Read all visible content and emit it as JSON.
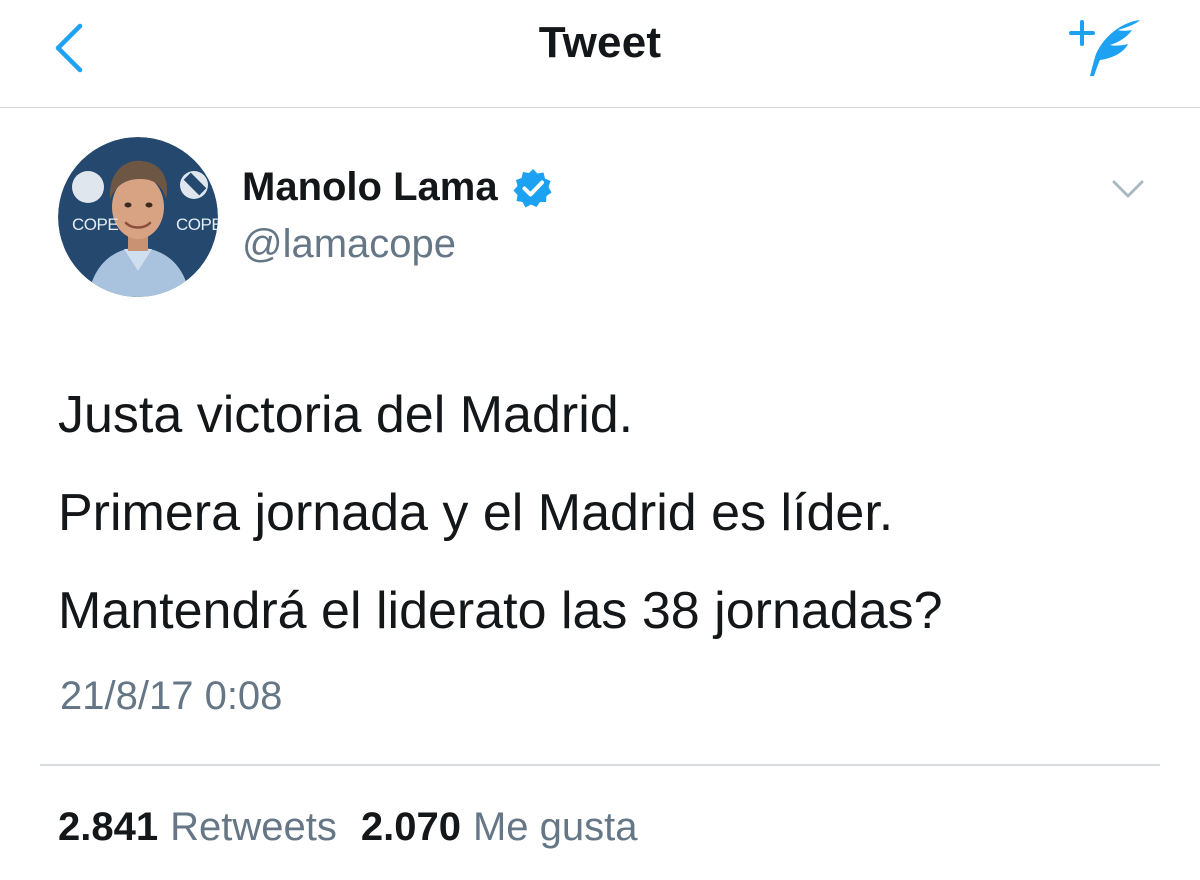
{
  "header": {
    "title": "Tweet",
    "back_icon": "chevron-left-icon",
    "compose_icon": "compose-feather-icon",
    "accent_color": "#1da1f2"
  },
  "author": {
    "name": "Manolo Lama",
    "handle": "@lamacope",
    "verified": true,
    "avatar_logo_text_left": "COPE",
    "avatar_logo_text_right": "COPE"
  },
  "tweet": {
    "lines": [
      "Justa victoria del Madrid.",
      "Primera jornada y el Madrid es líder.",
      "Mantendrá el liderato las 38 jornadas?"
    ],
    "timestamp": "21/8/17 0:08"
  },
  "stats": {
    "retweets_count": "2.841",
    "retweets_label": "Retweets",
    "likes_count": "2.070",
    "likes_label": "Me gusta"
  }
}
